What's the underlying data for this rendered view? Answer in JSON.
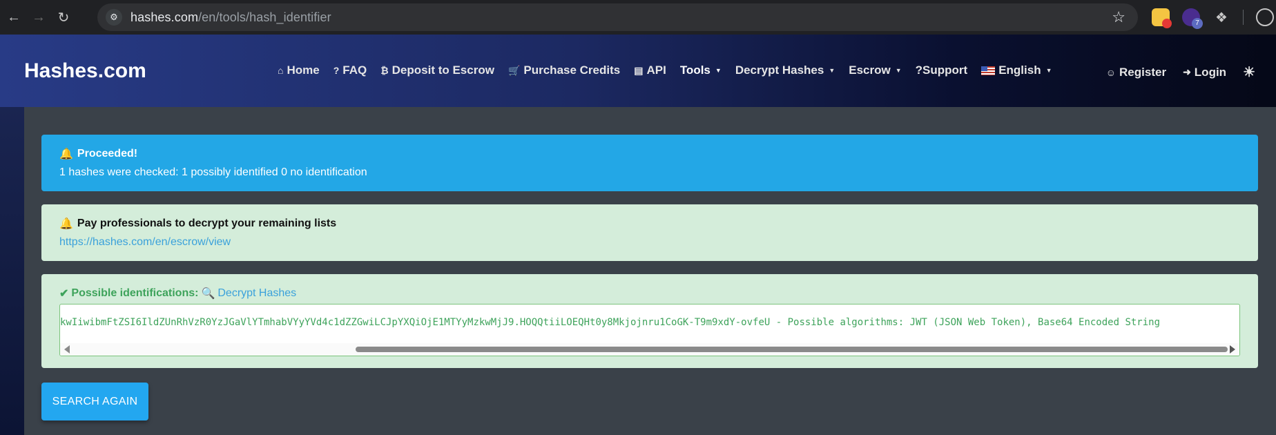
{
  "browser": {
    "url_host": "hashes.com",
    "url_path": "/en/tools/hash_identifier",
    "ext_badge_count": "7"
  },
  "navbar": {
    "brand": "Hashes.com",
    "items": [
      {
        "label": "Home",
        "icon": "home-icon"
      },
      {
        "label": "FAQ",
        "icon": "question-icon"
      },
      {
        "label": "Deposit to Escrow",
        "icon": "bitcoin-icon"
      },
      {
        "label": "Purchase Credits",
        "icon": "cart-icon"
      },
      {
        "label": "API",
        "icon": "server-icon"
      },
      {
        "label": "Tools",
        "icon": null,
        "dropdown": true,
        "active": true
      },
      {
        "label": "Decrypt Hashes",
        "icon": null,
        "dropdown": true
      },
      {
        "label": "Escrow",
        "icon": null,
        "dropdown": true
      },
      {
        "label": "?Support",
        "icon": null
      },
      {
        "label": "English",
        "icon": "us-flag-icon",
        "dropdown": true
      }
    ],
    "register": "Register",
    "login": "Login"
  },
  "alerts": {
    "proceeded_title": "Proceeded!",
    "proceeded_text": "1 hashes were checked: 1 possibly identified 0 no identification",
    "pay_title": "Pay professionals to decrypt your remaining lists",
    "pay_link": "https://hashes.com/en/escrow/view",
    "ident_title": "Possible identifications:",
    "ident_link": "Decrypt Hashes",
    "ident_result": "kwIiwibmFtZSI6IldZUnRhVzR0YzJGaVlYTmhabVYyYVd4c1dZZGwiLCJpYXQiOjE1MTYyMzkwMjJ9.HOQQtiiLOEQHt0y8Mkjojnru1CoGK-T9m9xdY-ovfeU - Possible algorithms: JWT (JSON Web Token), Base64 Encoded String"
  },
  "search_again": "SEARCH AGAIN",
  "colors": {
    "info": "#23a7e6",
    "success_bg": "#d4edda",
    "success_text": "#3ea35b",
    "link": "#3aa1db"
  }
}
